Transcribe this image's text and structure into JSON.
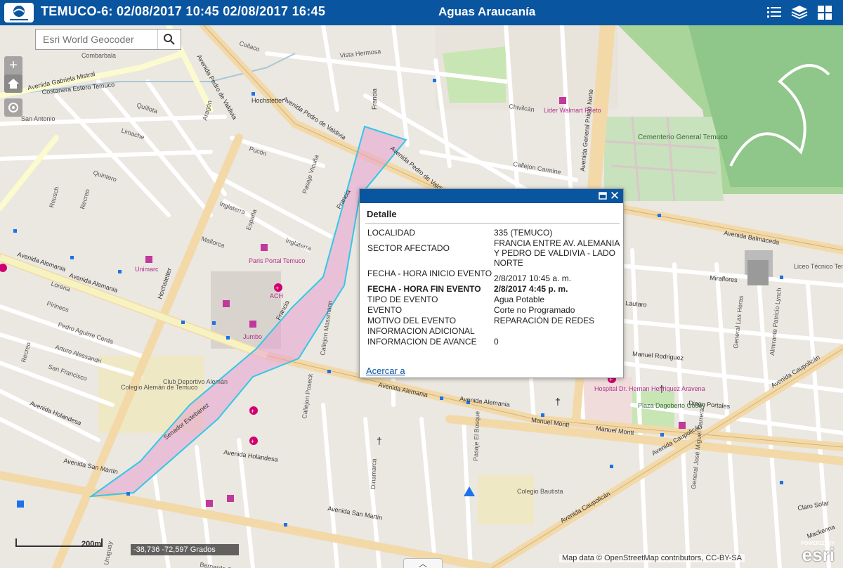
{
  "header": {
    "title": "TEMUCO-6: 02/08/2017 10:45 02/08/2017 16:45",
    "org": "Aguas Araucanía",
    "icons": [
      "list-icon",
      "layers-icon",
      "basemap-grid-icon"
    ]
  },
  "search": {
    "placeholder": "Esri World Geocoder"
  },
  "zoom": {
    "in": "+",
    "out": "−"
  },
  "popup": {
    "title": "Detalle",
    "rows": [
      {
        "label": "LOCALIDAD",
        "value": "335 (TEMUCO)"
      },
      {
        "label": "SECTOR AFECTADO",
        "value": "FRANCIA ENTRE AV. ALEMANIA Y PEDRO DE VALDIVIA - LADO NORTE"
      },
      {
        "label": "FECHA - HORA INICIO EVENTO",
        "value": "2/8/2017 10:45 a. m."
      },
      {
        "label": "FECHA - HORA FIN EVENTO",
        "value": "2/8/2017 4:45 p. m."
      },
      {
        "label": "TIPO DE EVENTO",
        "value": "Agua Potable"
      },
      {
        "label": "EVENTO",
        "value": "Corte no Programado"
      },
      {
        "label": "MOTIVO DEL EVENTO",
        "value": "REPARACIÓN DE REDES"
      },
      {
        "label": "INFORMACION ADICIONAL",
        "value": ""
      },
      {
        "label": "INFORMACION DE AVANCE",
        "value": "0"
      }
    ],
    "link": "Acercar a"
  },
  "coords": "-38,736 -72,597 Grados",
  "scale": "200m",
  "attribution": "Map data © OpenStreetMap contributors, CC-BY-SA",
  "esri_logo": "esri",
  "esri_powered": "POWERED BY",
  "bottom_toggle": "︿",
  "map_labels": {
    "alemania": "Avenida Alemania",
    "alemania2": "Avenida Alemania",
    "valdivia": "Avenida Pedro de Valdivia",
    "valdivia2": "Avenida Pedro de Valdivia",
    "gmistral": "Avenida Gabriela Mistral",
    "costanera": "Costanera Estero Temuco",
    "balmaceda": "Avenida Balmaceda",
    "montt": "Manuel Montt",
    "montt2": "Manuel Montt",
    "caupolican": "Avenida Caupolicán",
    "sanmartin": "Avenida San Martín",
    "sanmartin2": "Avenida San Martín",
    "holandesa": "Avenida Holandesa",
    "holandesa2": "Avenida Holandesa",
    "francia": "Francia",
    "hochstetter": "Hochstetter",
    "paris": "Paris Portal Temuco",
    "unimarc": "Unimarc",
    "jumbo": "Jumbo",
    "ach": "ACH",
    "lider": "Lider Walmart Prieto",
    "cementerio": "Cementerio General Temuco",
    "hospital": "Hospital Dr. Hernan Henriquez Aravena",
    "plaza": "Plaza Dagoberto Godoy",
    "colegio": "Colegio Alemán de Temuco",
    "club": "Club Deportivo Alemán",
    "bautista": "Colegio Bautista",
    "liceo": "Liceo Técnico Temuco",
    "prieto": "Avenida General Prieto Norte",
    "senador": "Senador Estebanez",
    "lautaro": "Lautaro",
    "portales": "Diego Portales",
    "rodriguez": "Manuel Rodriguez",
    "miraflores": "Miraflores",
    "claro": "Claro Solar",
    "mackenna": "Mackenna",
    "lynch": "Almirante Patricio Lynch",
    "vicuna": "Pasaje Vicuña",
    "inglaterra": "Inglaterra",
    "espana": "España",
    "mallorca": "Mallorca",
    "pucon": "Pucón",
    "aragon": "Aragón",
    "recreo": "Recreo",
    "reusch": "Reusch",
    "quintero": "Quintero",
    "limache": "Limache",
    "quillota": "Quillota",
    "lorena": "Lorena",
    "pirineos": "Pirineos",
    "cerda": "Pedro Aguirre Cerda",
    "alessandri": "Arturo Alessandri",
    "sanfrancisco": "San Francisco",
    "ohiggins": "Bernardo O'Higgins",
    "uruguay": "Uruguay",
    "dinamarca": "Dinamarca",
    "bosque": "Pasaje El Bosque",
    "poseck": "Callejon Poseck",
    "massmann": "Callejon Massmann",
    "carmine": "Callejon Carmine",
    "chivilcan": "Chivilcán",
    "vistahermosa": "Vista Hermosa",
    "coilaco": "Coilaco",
    "combarbala": "Combarbala",
    "sanantonio": "San Antonio",
    "lasheras": "General Las Heras",
    "carrera": "General José Miguel Carrera",
    "hochstetter2": "Hochstetter"
  }
}
